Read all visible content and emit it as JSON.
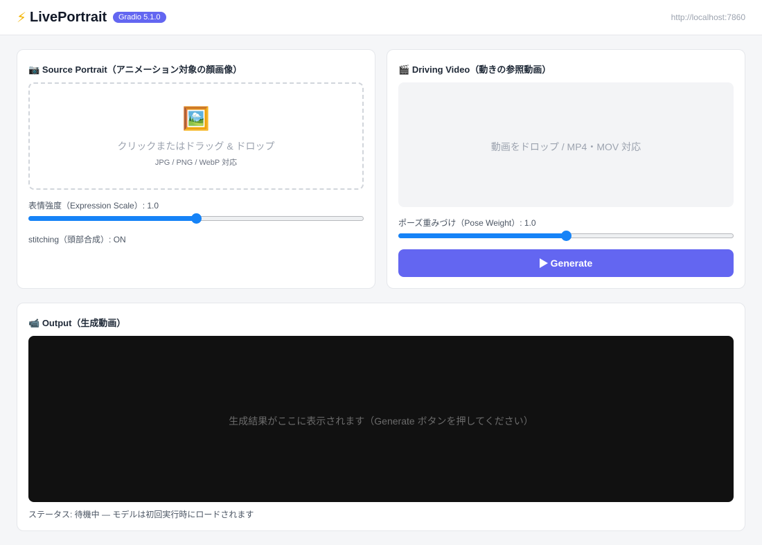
{
  "header": {
    "app_name": "LivePortrait",
    "bolt_icon": "⚡",
    "badge": "Gradio 5.1.0",
    "url": "http://localhost:7860"
  },
  "source_panel": {
    "icon": "📷",
    "title": "Source Portrait（アニメーション対象の顔画像）",
    "upload_icon": "🖼️",
    "upload_text": "クリックまたはドラッグ & ドロップ",
    "upload_formats": "JPG / PNG / WebP 対応",
    "expression_label": "表情強度（Expression Scale）: 1.0",
    "expression_slider": {
      "value": 1.0,
      "fraction": 0.5
    },
    "stitching_label": "stitching（頭部合成）: ON"
  },
  "driving_panel": {
    "icon": "🎬",
    "title": "Driving Video（動きの参照動画）",
    "drop_text": "動画をドロップ / MP4・MOV 対応",
    "pose_label": "ポーズ重みづけ（Pose Weight）: 1.0",
    "pose_slider": {
      "value": 1.0,
      "fraction": 0.5
    },
    "generate_label": "Generate",
    "generate_icon": "play-icon"
  },
  "output_panel": {
    "icon": "📹",
    "title": "Output（生成動画）",
    "placeholder": "生成結果がここに表示されます（Generate ボタンを押してください）",
    "status": "ステータス: 待機中 — モデルは初回実行時にロードされます"
  },
  "colors": {
    "accent": "#6366f1",
    "slider": "#1683f7",
    "output_bg": "#111111"
  }
}
